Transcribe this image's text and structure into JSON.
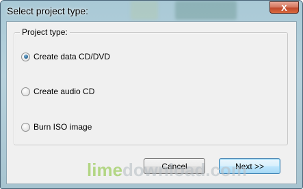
{
  "window": {
    "title": "Select project type:",
    "close_symbol": "X"
  },
  "group": {
    "legend": "Project type:",
    "options": [
      {
        "label": "Create data CD/DVD",
        "selected": true
      },
      {
        "label": "Create audio CD",
        "selected": false
      },
      {
        "label": "Burn ISO image",
        "selected": false
      }
    ]
  },
  "buttons": {
    "cancel": "Cancel",
    "next": "Next >>"
  },
  "watermark": {
    "part1": "lime",
    "part2": "download.com"
  },
  "colors": {
    "titlebar_glass": "#b7d1dc",
    "close_red": "#c14a2e",
    "radio_selected": "#1d5b8a",
    "default_button_border": "#3c7fb1",
    "watermark_green": "#8cc63f"
  }
}
